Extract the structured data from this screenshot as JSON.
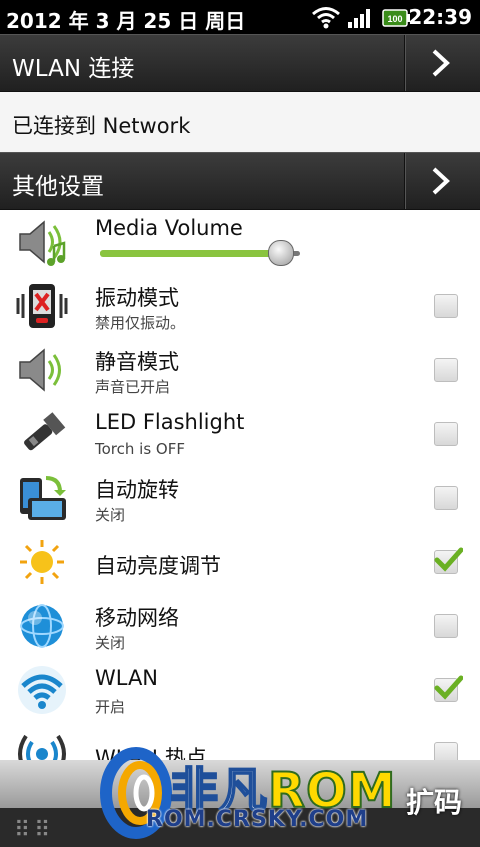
{
  "status_bar": {
    "date": "2012 年 3 月 25 日 周日",
    "time": "22:39",
    "battery": "100",
    "icons": [
      "wifi-icon",
      "signal-icon",
      "battery-icon"
    ]
  },
  "wlan_header": {
    "label": "WLAN 连接"
  },
  "connected": {
    "text": "已连接到 Network"
  },
  "other_header": {
    "label": "其他设置"
  },
  "media_volume": {
    "label": "Media Volume",
    "level": 0.9
  },
  "rows": [
    {
      "title": "振动模式",
      "subtitle": "禁用仅振动。",
      "icon": "vibrate-icon",
      "checked": false
    },
    {
      "title": "静音模式",
      "subtitle": "声音已开启",
      "icon": "speaker-icon",
      "checked": false
    },
    {
      "title": "LED Flashlight",
      "subtitle": "Torch is OFF",
      "icon": "flashlight-icon",
      "checked": false
    },
    {
      "title": "自动旋转",
      "subtitle": "关闭",
      "icon": "rotate-icon",
      "checked": false
    },
    {
      "title": "自动亮度调节",
      "subtitle": "",
      "icon": "sun-icon",
      "checked": true
    },
    {
      "title": "移动网络",
      "subtitle": "关闭",
      "icon": "globe-icon",
      "checked": false
    },
    {
      "title": "WLAN",
      "subtitle": "开启",
      "icon": "wifi-icon",
      "checked": true
    },
    {
      "title": "WLAN 热点",
      "subtitle": "",
      "icon": "hotspot-icon",
      "checked": false
    }
  ],
  "watermark": {
    "brand_left": "非凡",
    "brand_right": "ROM",
    "url": "ROM.CRSKY.COM",
    "corner": "扩码"
  },
  "colors": {
    "accent": "#8ac43f",
    "check": "#6ab023",
    "header": "#2e2e2e"
  }
}
